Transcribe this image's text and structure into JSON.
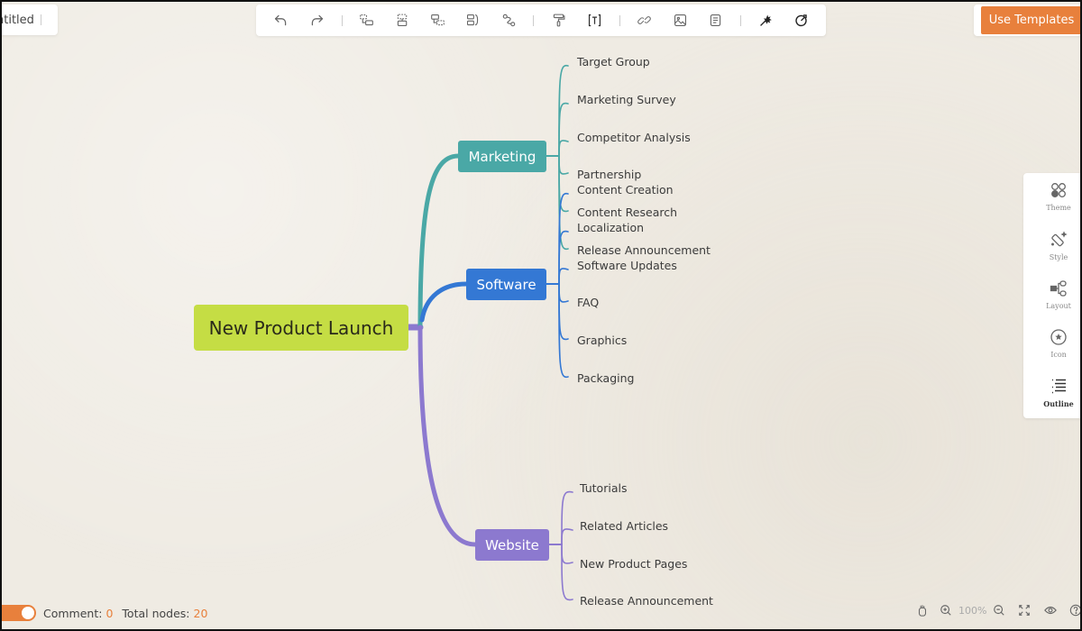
{
  "document": {
    "title": "Untitled",
    "title_visible": "ntitled"
  },
  "toolbar": {
    "items": [
      {
        "name": "undo-button",
        "icon": "undo-icon"
      },
      {
        "name": "redo-button",
        "icon": "redo-icon"
      },
      {
        "name": "add-subtopic-button",
        "icon": "subtopic-icon"
      },
      {
        "name": "add-topic-button",
        "icon": "topic-icon"
      },
      {
        "name": "add-floating-topic-button",
        "icon": "floating-topic-icon"
      },
      {
        "name": "add-summary-button",
        "icon": "summary-icon"
      },
      {
        "name": "add-relationship-button",
        "icon": "relationship-icon"
      },
      {
        "name": "format-painter-button",
        "icon": "paint-roller-icon"
      },
      {
        "name": "text-style-button",
        "icon": "text-icon"
      },
      {
        "name": "insert-link-button",
        "icon": "link-icon"
      },
      {
        "name": "insert-image-button",
        "icon": "image-icon"
      },
      {
        "name": "insert-note-button",
        "icon": "note-icon"
      },
      {
        "name": "ai-magic-button",
        "icon": "magic-wand-icon"
      },
      {
        "name": "target-button",
        "icon": "target-icon"
      }
    ]
  },
  "templates_button": "Use Templates",
  "side_panel": {
    "items": [
      {
        "label": "Theme",
        "icon": "theme-icon"
      },
      {
        "label": "Style",
        "icon": "style-icon"
      },
      {
        "label": "Layout",
        "icon": "layout-icon"
      },
      {
        "label": "Icon",
        "icon": "star-circle-icon"
      },
      {
        "label": "Outline",
        "icon": "outline-icon",
        "active": true
      }
    ]
  },
  "mindmap": {
    "root": {
      "label": "New Product Launch",
      "color": "#c5dd44"
    },
    "branches": [
      {
        "label": "Marketing",
        "color": "#4aa8a6",
        "children": [
          "Target Group",
          "Marketing Survey",
          "Competitor Analysis",
          "Partnership",
          "Content Research",
          "Release Announcement"
        ]
      },
      {
        "label": "Software",
        "color": "#3478d4",
        "children": [
          "Content Creation",
          "Localization",
          "Software Updates",
          "FAQ",
          "Graphics",
          "Packaging"
        ]
      },
      {
        "label": "Website",
        "color": "#8c79cf",
        "children": [
          "Tutorials",
          "Related Articles",
          "New Product Pages",
          "Release Announcement"
        ]
      }
    ]
  },
  "status": {
    "comment_label": "Comment:",
    "comment_count": "0",
    "nodes_label": "Total nodes:",
    "nodes_count": "20",
    "toggle_on": true
  },
  "zoom": {
    "level": "100%"
  },
  "colors": {
    "accent": "#e8803c",
    "canvas": "#efebe3"
  }
}
